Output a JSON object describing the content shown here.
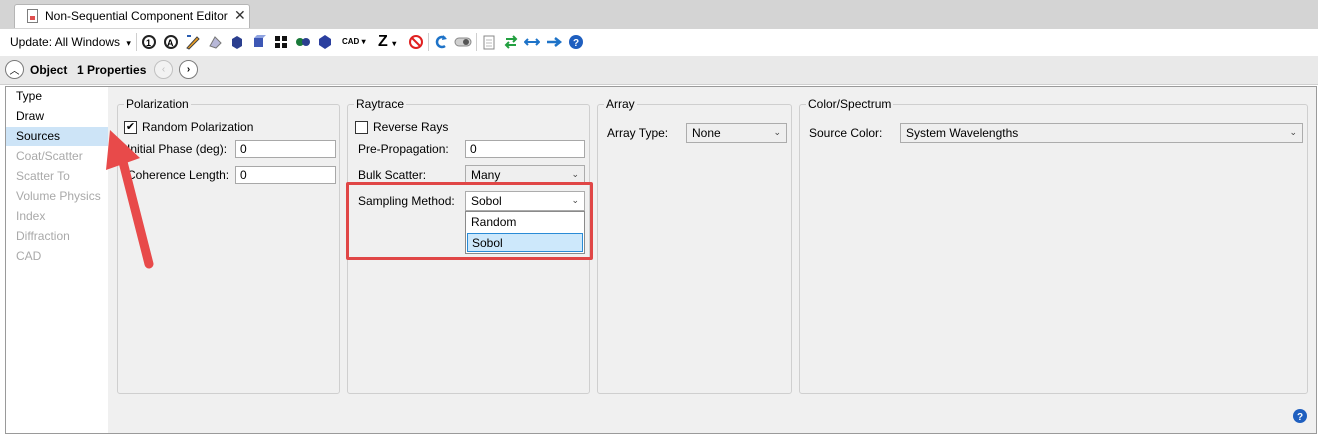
{
  "tab": {
    "title": "Non-Sequential Component Editor",
    "close": "✕"
  },
  "toolbar": {
    "update_label": "Update: All Windows",
    "update_arrow": "▾",
    "cad_label": "CAD",
    "z_label": "Z",
    "icons": [
      "refresh-icon",
      "refresh-all-icon",
      "edit-icon",
      "shaded-model-icon",
      "solid-model-icon",
      "cube-icon",
      "layout-icon",
      "spheres-icon",
      "hexagon-icon",
      "cad-dropdown",
      "z-dropdown",
      "stop-icon",
      "undo-icon",
      "toggle-icon",
      "clipboard-icon",
      "swap-icon",
      "resize-icon",
      "arrow-right-icon",
      "help-icon"
    ]
  },
  "objbar": {
    "object": "Object",
    "properties": "1 Properties"
  },
  "left_list": {
    "items": [
      {
        "label": "Type",
        "state": "normal"
      },
      {
        "label": "Draw",
        "state": "normal"
      },
      {
        "label": "Sources",
        "state": "selected"
      },
      {
        "label": "Coat/Scatter",
        "state": "disabled"
      },
      {
        "label": "Scatter To",
        "state": "disabled"
      },
      {
        "label": "Volume Physics",
        "state": "disabled"
      },
      {
        "label": "Index",
        "state": "disabled"
      },
      {
        "label": "Diffraction",
        "state": "disabled"
      },
      {
        "label": "CAD",
        "state": "disabled"
      }
    ]
  },
  "polarization": {
    "title": "Polarization",
    "random_label": "Random Polarization",
    "random_checked": true,
    "phase_label": "Initial Phase (deg):",
    "phase_value": "0",
    "coherence_label": "Coherence Length:",
    "coherence_value": "0"
  },
  "raytrace": {
    "title": "Raytrace",
    "reverse_label": "Reverse Rays",
    "reverse_checked": false,
    "prepropagation_label": "Pre-Propagation:",
    "prepropagation_value": "0",
    "bulk_label": "Bulk Scatter:",
    "bulk_value": "Many",
    "sampling_label": "Sampling Method:",
    "sampling_value": "Sobol",
    "sampling_options": [
      "Random",
      "Sobol"
    ],
    "highlighted_option": "Sobol"
  },
  "array": {
    "title": "Array",
    "type_label": "Array Type:",
    "type_value": "None"
  },
  "color": {
    "title": "Color/Spectrum",
    "source_label": "Source Color:",
    "source_value": "System Wavelengths"
  },
  "colors": {
    "selection": "#cde4f7",
    "highlight_box": "#e04646",
    "arrow": "#e84a4a",
    "dropdown_hover": "#cde8fb",
    "help_blue": "#1f5fbf"
  }
}
